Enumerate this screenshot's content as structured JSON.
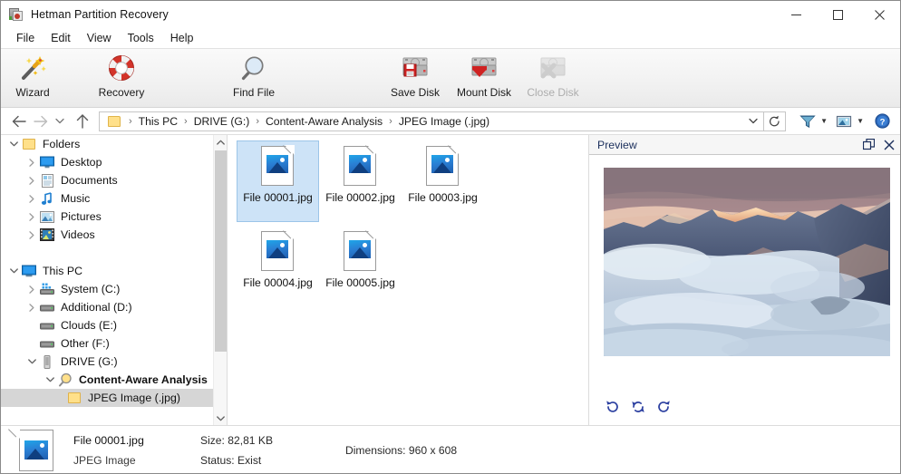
{
  "window": {
    "title": "Hetman Partition Recovery",
    "icon": "app-icon",
    "buttons": {
      "minimize": "minimize-icon",
      "maximize": "maximize-icon",
      "close": "close-icon"
    }
  },
  "menubar": {
    "items": [
      "File",
      "Edit",
      "View",
      "Tools",
      "Help"
    ]
  },
  "toolbar": {
    "buttons": [
      {
        "label": "Wizard",
        "icon": "magic-wand-icon",
        "disabled": false
      },
      {
        "label": "Recovery",
        "icon": "lifebuoy-icon",
        "disabled": false
      },
      {
        "label": "Find File",
        "icon": "magnifier-icon",
        "disabled": false
      },
      {
        "label": "Save Disk",
        "icon": "save-disk-icon",
        "disabled": false
      },
      {
        "label": "Mount Disk",
        "icon": "mount-disk-icon",
        "disabled": false
      },
      {
        "label": "Close Disk",
        "icon": "close-disk-icon",
        "disabled": true
      }
    ]
  },
  "addressbar": {
    "back": "back-arrow-icon",
    "forward": "forward-arrow-icon",
    "history": "chevron-down-icon",
    "up": "up-arrow-icon",
    "folder_icon": "folder-icon",
    "crumbs": [
      "This PC",
      "DRIVE (G:)",
      "Content-Aware Analysis",
      "JPEG Image (.jpg)"
    ],
    "separator": "›",
    "dropdown": "chevron-down-icon",
    "refresh": "refresh-icon",
    "right_tools": [
      {
        "name": "filter-icon",
        "caret": true
      },
      {
        "name": "view-mode-icon",
        "caret": true
      },
      {
        "name": "help-icon",
        "caret": false
      }
    ]
  },
  "tree": {
    "rows": [
      {
        "label": "Folders",
        "depth": 0,
        "twisty": "down",
        "icon": "folder-icon",
        "selected": false,
        "bold": false
      },
      {
        "label": "Desktop",
        "depth": 1,
        "twisty": "right",
        "icon": "desktop-icon",
        "selected": false,
        "bold": false
      },
      {
        "label": "Documents",
        "depth": 1,
        "twisty": "right",
        "icon": "documents-icon",
        "selected": false,
        "bold": false
      },
      {
        "label": "Music",
        "depth": 1,
        "twisty": "right",
        "icon": "music-icon",
        "selected": false,
        "bold": false
      },
      {
        "label": "Pictures",
        "depth": 1,
        "twisty": "right",
        "icon": "pictures-icon",
        "selected": false,
        "bold": false
      },
      {
        "label": "Videos",
        "depth": 1,
        "twisty": "right",
        "icon": "videos-icon",
        "selected": false,
        "bold": false
      },
      {
        "label": "",
        "depth": 0,
        "twisty": "none",
        "icon": "spacer",
        "selected": false,
        "bold": false
      },
      {
        "label": "This PC",
        "depth": 0,
        "twisty": "down",
        "icon": "this-pc-icon",
        "selected": false,
        "bold": false
      },
      {
        "label": "System (C:)",
        "depth": 1,
        "twisty": "right",
        "icon": "system-drive-icon",
        "selected": false,
        "bold": false
      },
      {
        "label": "Additional (D:)",
        "depth": 1,
        "twisty": "right",
        "icon": "hard-drive-icon",
        "selected": false,
        "bold": false
      },
      {
        "label": "Clouds (E:)",
        "depth": 1,
        "twisty": "none",
        "icon": "hard-drive-icon",
        "selected": false,
        "bold": false
      },
      {
        "label": "Other (F:)",
        "depth": 1,
        "twisty": "none",
        "icon": "hard-drive-icon",
        "selected": false,
        "bold": false
      },
      {
        "label": "DRIVE (G:)",
        "depth": 1,
        "twisty": "down",
        "icon": "usb-drive-icon",
        "selected": false,
        "bold": false
      },
      {
        "label": "Content-Aware Analysis",
        "depth": 2,
        "twisty": "down",
        "icon": "analysis-icon",
        "selected": false,
        "bold": true
      },
      {
        "label": "JPEG Image (.jpg)",
        "depth": 3,
        "twisty": "none",
        "icon": "folder-icon",
        "selected": true,
        "bold": false
      }
    ],
    "scrollbar": {
      "up": "scroll-up-icon",
      "down": "scroll-down-icon"
    }
  },
  "files": {
    "items": [
      {
        "name": "File 00001.jpg",
        "selected": true
      },
      {
        "name": "File 00002.jpg",
        "selected": false
      },
      {
        "name": "File 00003.jpg",
        "selected": false
      },
      {
        "name": "File 00004.jpg",
        "selected": false
      },
      {
        "name": "File 00005.jpg",
        "selected": false
      }
    ]
  },
  "preview": {
    "title": "Preview",
    "undock_icon": "undock-icon",
    "close_icon": "close-icon",
    "image_alt": "mountain-range-above-clouds-at-sunset",
    "rotate_buttons": [
      {
        "name": "rotate-left-icon"
      },
      {
        "name": "flip-icon"
      },
      {
        "name": "rotate-right-icon"
      }
    ]
  },
  "status": {
    "file_icon": "jpg-file-icon",
    "name": "File 00001.jpg",
    "type": "JPEG Image",
    "size_label": "Size:",
    "size_value": "82,81 KB",
    "status_label": "Status:",
    "status_value": "Exist",
    "dimensions_label": "Dimensions:",
    "dimensions_value": "960 x 608"
  },
  "colors": {
    "selection_blue": "#cde3f7",
    "tree_selection_gray": "#d6d6d6",
    "accent_red": "#c0392b",
    "preview_title": "#1b2f5c",
    "rotate_blue": "#2b3fa0"
  }
}
